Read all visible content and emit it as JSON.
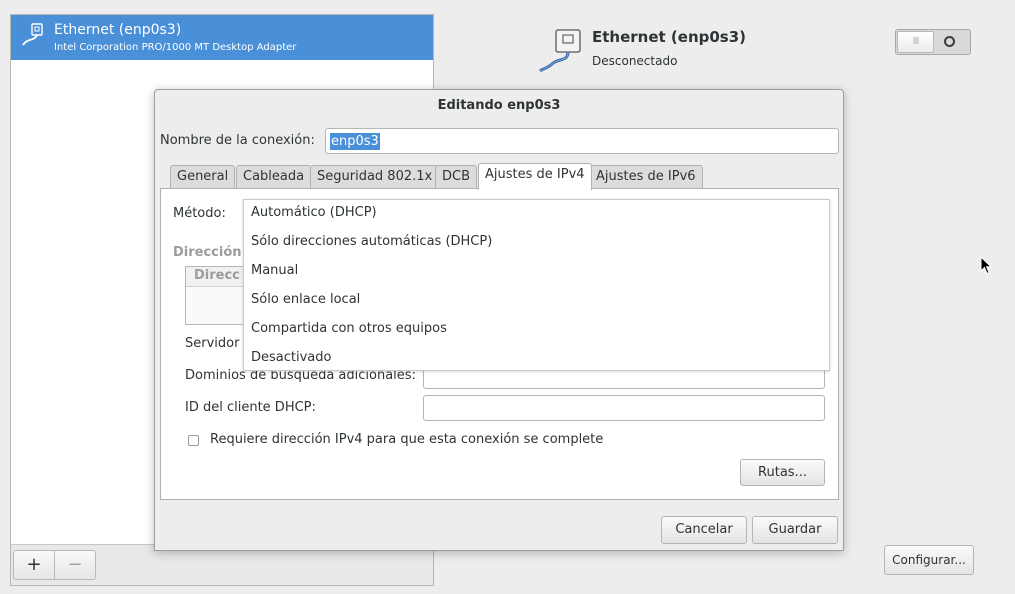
{
  "sidebar": {
    "devices": [
      {
        "name": "Ethernet (enp0s3)",
        "subtitle": "Intel Corporation PRO/1000 MT Desktop Adapter",
        "selected": true
      }
    ],
    "add_label": "+",
    "remove_label": "−"
  },
  "device_header": {
    "title": "Ethernet (enp0s3)",
    "status": "Desconectado",
    "icon": "ethernet-cable-icon"
  },
  "toggle": {
    "state": "off",
    "on_glyph": "III"
  },
  "configure_label": "Configurar...",
  "dialog": {
    "title": "Editando enp0s3",
    "connection_name_label": "Nombre de la conexión:",
    "connection_name_value": "enp0s3",
    "tabs": [
      {
        "label": "General"
      },
      {
        "label": "Cableada"
      },
      {
        "label": "Seguridad 802.1x"
      },
      {
        "label": "DCB"
      },
      {
        "label": "Ajustes de IPv4",
        "active": true
      },
      {
        "label": "Ajustes de IPv6"
      }
    ],
    "ipv4": {
      "method_label": "Método:",
      "method_options": [
        "Automático (DHCP)",
        "Sólo direcciones automáticas (DHCP)",
        "Manual",
        "Sólo enlace local",
        "Compartida con otros equipos",
        "Desactivado"
      ],
      "addresses_heading": "Dirección",
      "addresses_column": "Direcc",
      "dns_label": "Servidor",
      "search_domains_label": "Dominios de búsqueda adicionales:",
      "search_domains_value": "",
      "dhcp_id_label": "ID del cliente DHCP:",
      "dhcp_id_value": "",
      "require_label": "Requiere dirección IPv4 para que esta conexión se complete",
      "require_checked": false,
      "routes_label": "Rutas..."
    },
    "cancel_label": "Cancelar",
    "save_label": "Guardar"
  },
  "colors": {
    "selection": "#4a90d9",
    "window_bg": "#ededed",
    "panel_bg": "#ffffff"
  }
}
